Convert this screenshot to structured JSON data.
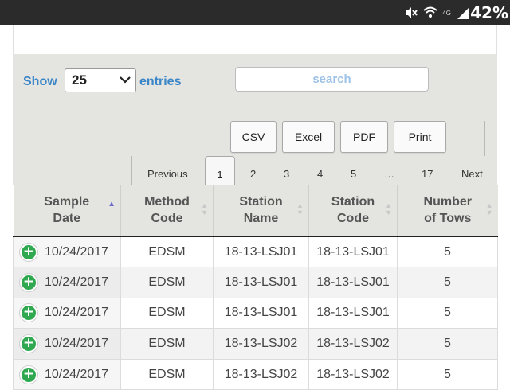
{
  "status_bar": {
    "battery": "42%",
    "network": "4G"
  },
  "controls": {
    "show_label": "Show",
    "entries_value": "25",
    "entries_label": "entries",
    "search_placeholder": "search"
  },
  "buttons": [
    "CSV",
    "Excel",
    "PDF",
    "Print"
  ],
  "pagination": {
    "previous": "Previous",
    "pages": [
      "1",
      "2",
      "3",
      "4",
      "5",
      "…",
      "17"
    ],
    "next": "Next",
    "active": "1"
  },
  "table": {
    "columns": [
      {
        "line1": "Sample",
        "line2": "Date"
      },
      {
        "line1": "Method",
        "line2": "Code"
      },
      {
        "line1": "Station",
        "line2": "Name"
      },
      {
        "line1": "Station",
        "line2": "Code"
      },
      {
        "line1": "Number",
        "line2": "of Tows"
      }
    ],
    "rows": [
      [
        "10/24/2017",
        "EDSM",
        "18-13-LSJ01",
        "18-13-LSJ01",
        "5"
      ],
      [
        "10/24/2017",
        "EDSM",
        "18-13-LSJ01",
        "18-13-LSJ01",
        "5"
      ],
      [
        "10/24/2017",
        "EDSM",
        "18-13-LSJ01",
        "18-13-LSJ01",
        "5"
      ],
      [
        "10/24/2017",
        "EDSM",
        "18-13-LSJ02",
        "18-13-LSJ02",
        "5"
      ],
      [
        "10/24/2017",
        "EDSM",
        "18-13-LSJ02",
        "18-13-LSJ02",
        "5"
      ]
    ]
  },
  "colors": {
    "accent": "#3a86c8",
    "expand_button": "#2fa84f",
    "panel_bg": "#e4e4e0"
  }
}
